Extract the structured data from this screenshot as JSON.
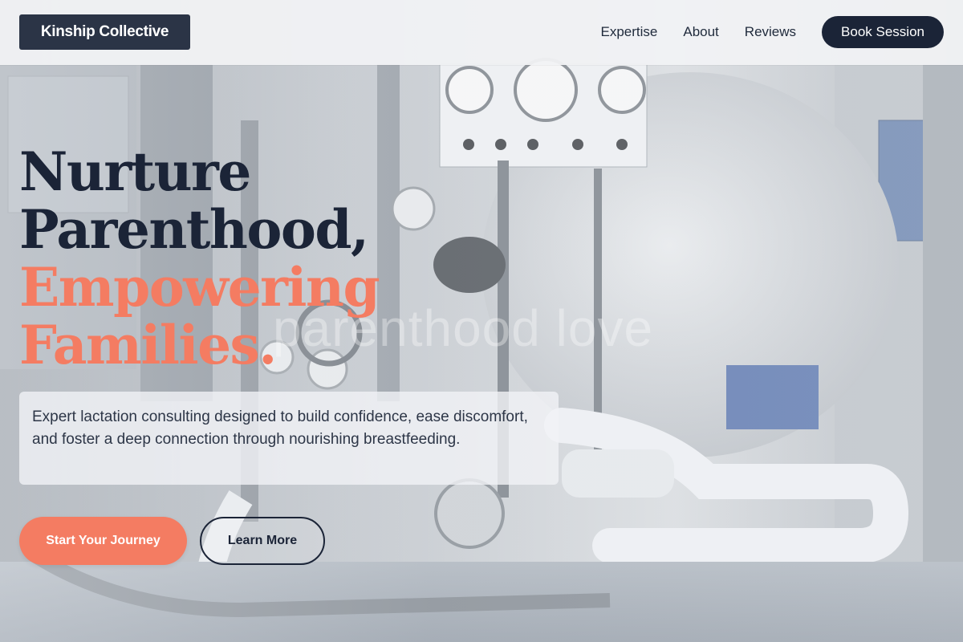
{
  "header": {
    "brand": "Kinship Collective",
    "nav": [
      {
        "label": "Expertise"
      },
      {
        "label": "About"
      },
      {
        "label": "Reviews"
      }
    ],
    "cta_label": "Book Session"
  },
  "hero": {
    "heading_lines": [
      "Nurture",
      "Parenthood,",
      "Empowering",
      "Families."
    ],
    "watermark": "parenthood love",
    "subtitle": "Expert lactation consulting designed to build confidence, ease discomfort, and foster a deep connection through nourishing breastfeeding.",
    "primary_cta": "Start Your Journey",
    "secondary_cta": "Learn More",
    "background": "industrial machinery photo"
  },
  "colors": {
    "navy": "#1b2437",
    "accent": "#f47c62",
    "header_bg": "#f1f2f4"
  }
}
